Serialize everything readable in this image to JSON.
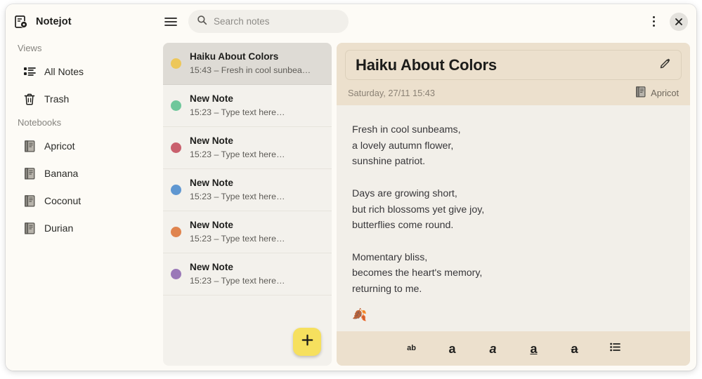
{
  "header": {
    "app_icon": "note-gear-icon",
    "app_title": "Notejot",
    "menu_icon": "hamburger-icon",
    "search": {
      "icon": "search-icon",
      "value": "",
      "placeholder": "Search notes"
    },
    "overflow_icon": "more-vertical-icon",
    "close_icon": "close-icon"
  },
  "sidebar": {
    "views_label": "Views",
    "views": [
      {
        "label": "All Notes",
        "icon": "list-icon"
      },
      {
        "label": "Trash",
        "icon": "trash-icon"
      }
    ],
    "notebooks_label": "Notebooks",
    "notebooks": [
      {
        "label": "Apricot",
        "icon": "notebook-icon"
      },
      {
        "label": "Banana",
        "icon": "notebook-icon"
      },
      {
        "label": "Coconut",
        "icon": "notebook-icon"
      },
      {
        "label": "Durian",
        "icon": "notebook-icon"
      }
    ]
  },
  "note_list": {
    "new_note_icon": "plus-icon",
    "items": [
      {
        "title": "Haiku About Colors",
        "subtitle": "15:43 – Fresh in cool sunbea…",
        "color": "#edc75a",
        "selected": true
      },
      {
        "title": "New Note",
        "subtitle": "15:23 – Type text here…",
        "color": "#6fc79b",
        "selected": false
      },
      {
        "title": "New Note",
        "subtitle": "15:23 – Type text here…",
        "color": "#c9606d",
        "selected": false
      },
      {
        "title": "New Note",
        "subtitle": "15:23 – Type text here…",
        "color": "#5f97d1",
        "selected": false
      },
      {
        "title": "New Note",
        "subtitle": "15:23 – Type text here…",
        "color": "#e0844e",
        "selected": false
      },
      {
        "title": "New Note",
        "subtitle": "15:23 – Type text here…",
        "color": "#9a78b8",
        "selected": false
      }
    ]
  },
  "editor": {
    "title": "Haiku About Colors",
    "edit_icon": "pencil-icon",
    "date": "Saturday, 27/11 15:43",
    "notebook": "Apricot",
    "notebook_icon": "notebook-icon",
    "content": "Fresh in cool sunbeams,\na lovely autumn flower,\nsunshine patriot.\n\nDays are growing short,\nbut rich blossoms yet give joy,\nbutterflies come round.\n\nMomentary bliss,\nbecomes the heart's memory,\nreturning to me.",
    "emoji": "🍂",
    "toolbar": [
      {
        "name": "format-text",
        "glyph": "ab",
        "style": "small"
      },
      {
        "name": "bold",
        "glyph": "a",
        "style": "bold"
      },
      {
        "name": "italic",
        "glyph": "a",
        "style": "italic"
      },
      {
        "name": "underline",
        "glyph": "a",
        "style": "underline"
      },
      {
        "name": "strikethrough",
        "glyph": "a",
        "style": "strike"
      },
      {
        "name": "bullet-list",
        "glyph": "",
        "style": "list"
      }
    ]
  },
  "colors": {
    "window_bg": "#fdfbf6",
    "list_bg": "#f3f1ec",
    "editor_head_bg": "#ece0cd",
    "editor_body_bg": "#f2efe9",
    "accent": "#f6e05e"
  }
}
